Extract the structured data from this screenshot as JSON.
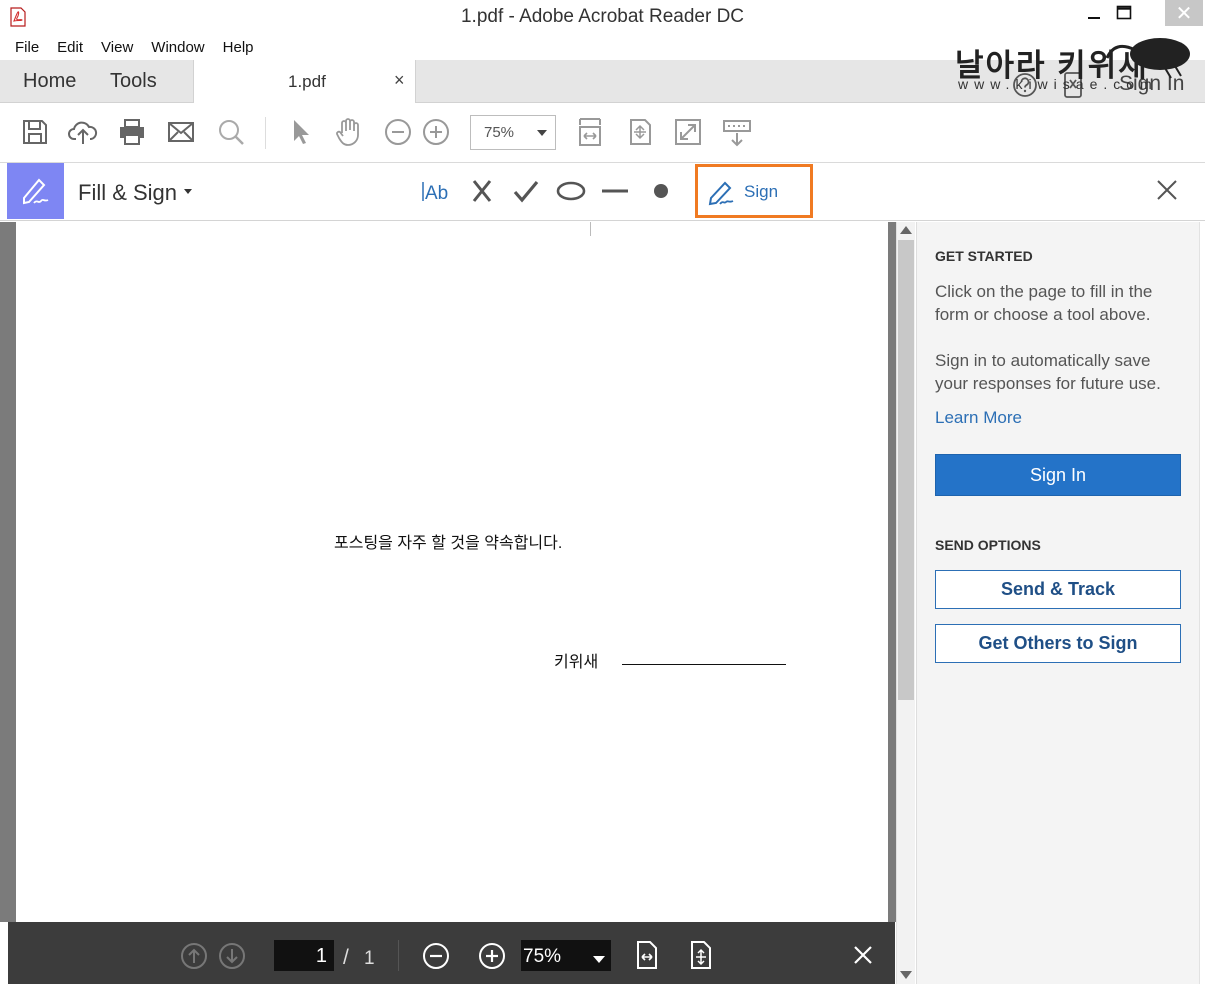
{
  "window": {
    "title": "1.pdf - Adobe Acrobat Reader DC",
    "close_glyph": "✕"
  },
  "menu": [
    "File",
    "Edit",
    "View",
    "Window",
    "Help"
  ],
  "tabs": {
    "home": "Home",
    "tools": "Tools",
    "document": "1.pdf",
    "document_close": "×",
    "sign_in": "Sign In"
  },
  "watermark": {
    "title": "날아라 키위새",
    "url": "www.kiwisae.com"
  },
  "toolbar": {
    "zoom": "75%",
    "icons": [
      "save-icon",
      "upload-cloud-icon",
      "print-icon",
      "email-icon",
      "search-icon",
      "select-arrow-icon",
      "hand-icon",
      "zoom-out-icon",
      "zoom-in-icon",
      "fit-width-icon",
      "rotate-icon",
      "fullscreen-icon",
      "read-mode-icon"
    ]
  },
  "fill_sign": {
    "title": "Fill & Sign",
    "sign_label": "Sign",
    "accent": "#7e86f3",
    "highlight": "#f07a22"
  },
  "document": {
    "body_text": "포스팅을 자주 할 것을 약속합니다.",
    "signer_name": "키위새"
  },
  "pagebar": {
    "page_current": "1",
    "separator": "/",
    "page_total": "1",
    "zoom": "75%"
  },
  "panel": {
    "get_started_heading": "GET STARTED",
    "text1": "Click on the page to fill in the form or choose a tool above.",
    "text2": "Sign in to automatically save your responses for future use.",
    "learn_more": "Learn More",
    "sign_in_button": "Sign In",
    "send_options_heading": "SEND OPTIONS",
    "send_track": "Send & Track",
    "get_others": "Get Others to Sign",
    "accent": "#2473c8"
  }
}
